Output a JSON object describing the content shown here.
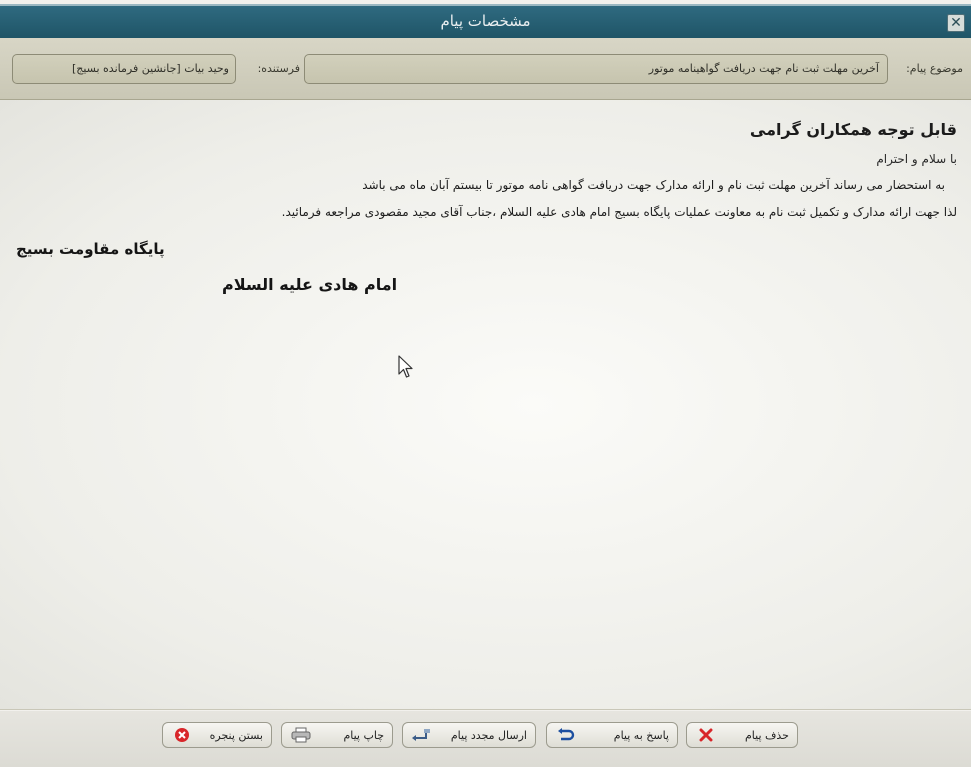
{
  "window": {
    "title": "مشخصات پیام",
    "close_glyph": "✕"
  },
  "header": {
    "subject_label": "موضوع پیام:",
    "subject_value": "آخرین مهلت ثبت نام جهت دریافت گواهینامه موتور",
    "sender_label": "فرستنده:",
    "sender_value": "وحید بیات [جانشین فرمانده بسیج]"
  },
  "message": {
    "heading": "قابل توجه همکاران گرامی",
    "greeting": "با سلام و احترام",
    "line2": "به استحضار می رساند آخرین مهلت ثبت نام و ارائه مدارک جهت دریافت گواهی نامه موتور  تا بیستم آبان ماه می باشد",
    "line3": "لذا جهت ارائه مدارک و تکمیل ثبت نام به معاونت عملیات پایگاه بسیج امام هادی علیه السلام ،جناب آقای مجید مقصودی مراجعه فرمائید.",
    "signature_org": "پایگاه مقاومت بسیج",
    "signature_name": "امام هادی علیه السلام"
  },
  "footer": {
    "delete_label": "حذف پیام",
    "reply_label": "پاسخ به پیام",
    "forward_label": "ارسال مجدد پیام",
    "print_label": "چاپ پیام",
    "close_label": "بستن پنجره"
  },
  "colors": {
    "titlebar": "#1f5567",
    "delete_icon": "#d8262a",
    "reply_icon": "#1d4fa0",
    "close_icon": "#d8262a"
  },
  "icons": {
    "delete": "x-icon",
    "reply": "reply-arrow-icon",
    "forward": "forward-arrow-icon",
    "print": "printer-icon",
    "close": "close-circle-icon",
    "cursor": "mouse-pointer-icon"
  }
}
